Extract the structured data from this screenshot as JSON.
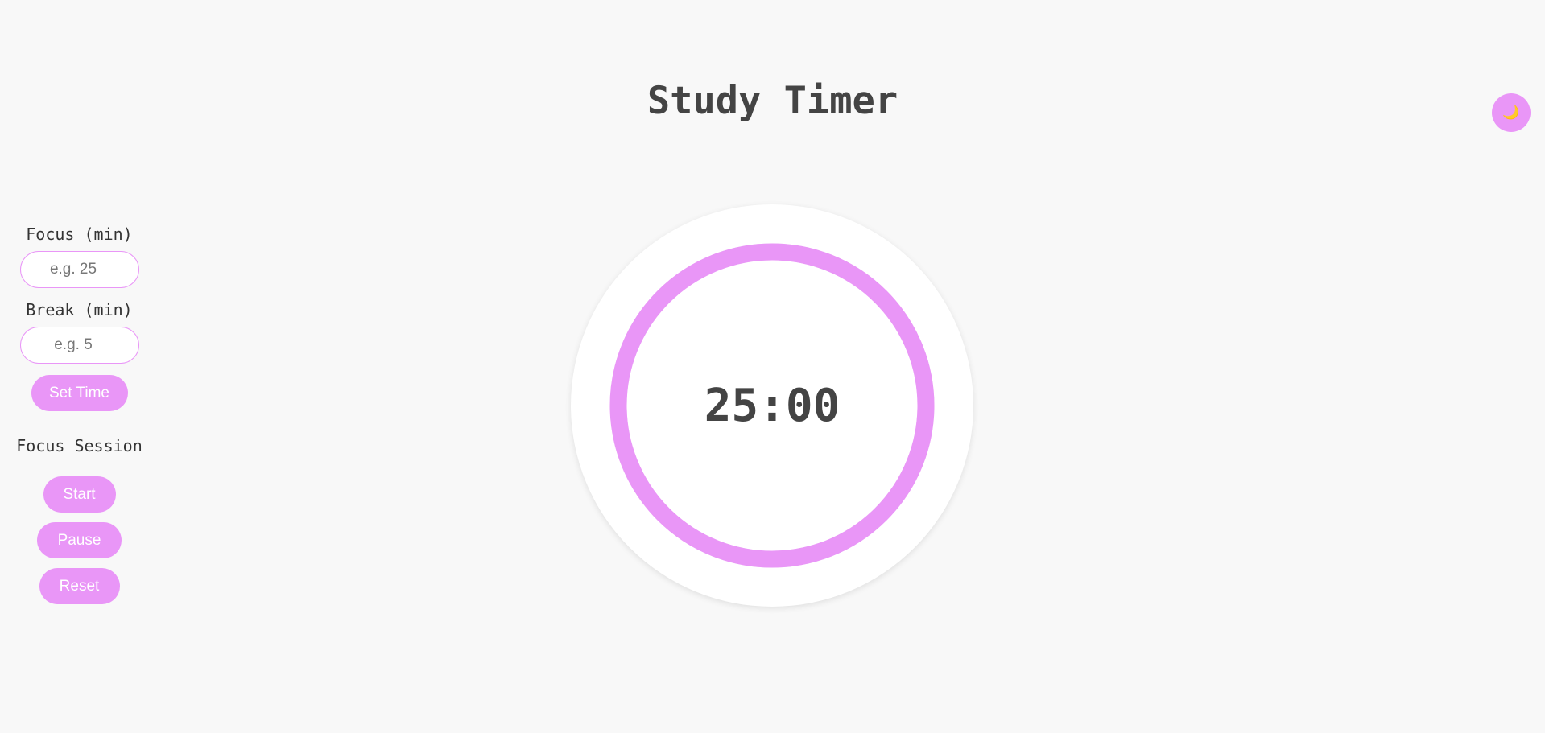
{
  "header": {
    "title": "Study Timer"
  },
  "theme_toggle": {
    "icon": "moon-icon",
    "glyph": "🌙"
  },
  "settings": {
    "focus_label": "Focus (min)",
    "focus_placeholder": "e.g. 25",
    "focus_value": "",
    "break_label": "Break (min)",
    "break_placeholder": "e.g. 5",
    "break_value": "",
    "set_button_label": "Set Time"
  },
  "session": {
    "label": "Focus Session"
  },
  "controls": {
    "start_label": "Start",
    "pause_label": "Pause",
    "reset_label": "Reset"
  },
  "timer": {
    "display": "25:00",
    "progress": 1.0
  },
  "colors": {
    "accent": "#e996f7",
    "background": "#f8f8f8",
    "text": "#444444",
    "moon": "#f5c542"
  }
}
